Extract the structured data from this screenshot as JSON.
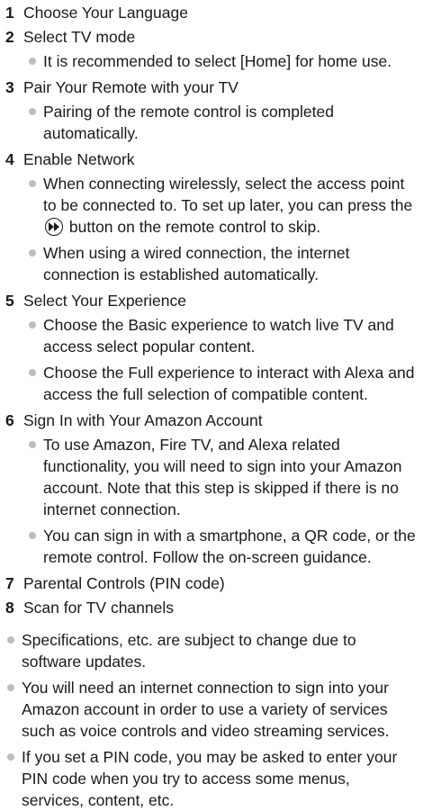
{
  "steps": [
    {
      "num": "1",
      "title": "Choose Your Language"
    },
    {
      "num": "2",
      "title": "Select TV mode",
      "bullets": [
        "It is recommended to select [Home] for home use."
      ]
    },
    {
      "num": "3",
      "title": "Pair Your Remote with your TV",
      "bullets": [
        "Pairing of the remote control is completed automatically."
      ]
    },
    {
      "num": "4",
      "title": "Enable Network",
      "bullet_wireless_before": "When connecting wirelessly, select the access point to be connected to. To set up later, you can press the",
      "bullet_wireless_after": "button on the remote control to skip.",
      "bullet_wired": "When using a wired connection, the internet connection is established automatically."
    },
    {
      "num": "5",
      "title": "Select Your Experience",
      "bullets": [
        "Choose the Basic experience to watch live TV and access select popular content.",
        "Choose the Full experience to interact with Alexa and access the full selection of compatible content."
      ]
    },
    {
      "num": "6",
      "title": "Sign In with Your Amazon Account",
      "bullets": [
        "To use Amazon, Fire TV, and Alexa related functionality, you will need to sign into your Amazon account. Note that this step is skipped if there is no internet connection.",
        "You can sign in with a smartphone, a QR code, or the remote control. Follow the on-screen guidance."
      ]
    },
    {
      "num": "7",
      "title": "Parental Controls (PIN code)"
    },
    {
      "num": "8",
      "title": "Scan for TV channels"
    }
  ],
  "notes": [
    "Specifications, etc. are subject to change due to software updates.",
    "You will need an internet connection to sign into your Amazon account in order to use a variety of services such as voice controls and video streaming services.",
    "If you set a PIN code, you may be asked to enter your PIN code when you try to access some menus, services, content, etc."
  ],
  "icons": {
    "skip": "fast-forward-skip-icon",
    "bullet": "bullet-dot-icon"
  },
  "colors": {
    "text": "#1a1a1a",
    "bullet": "#bdbdbd"
  }
}
